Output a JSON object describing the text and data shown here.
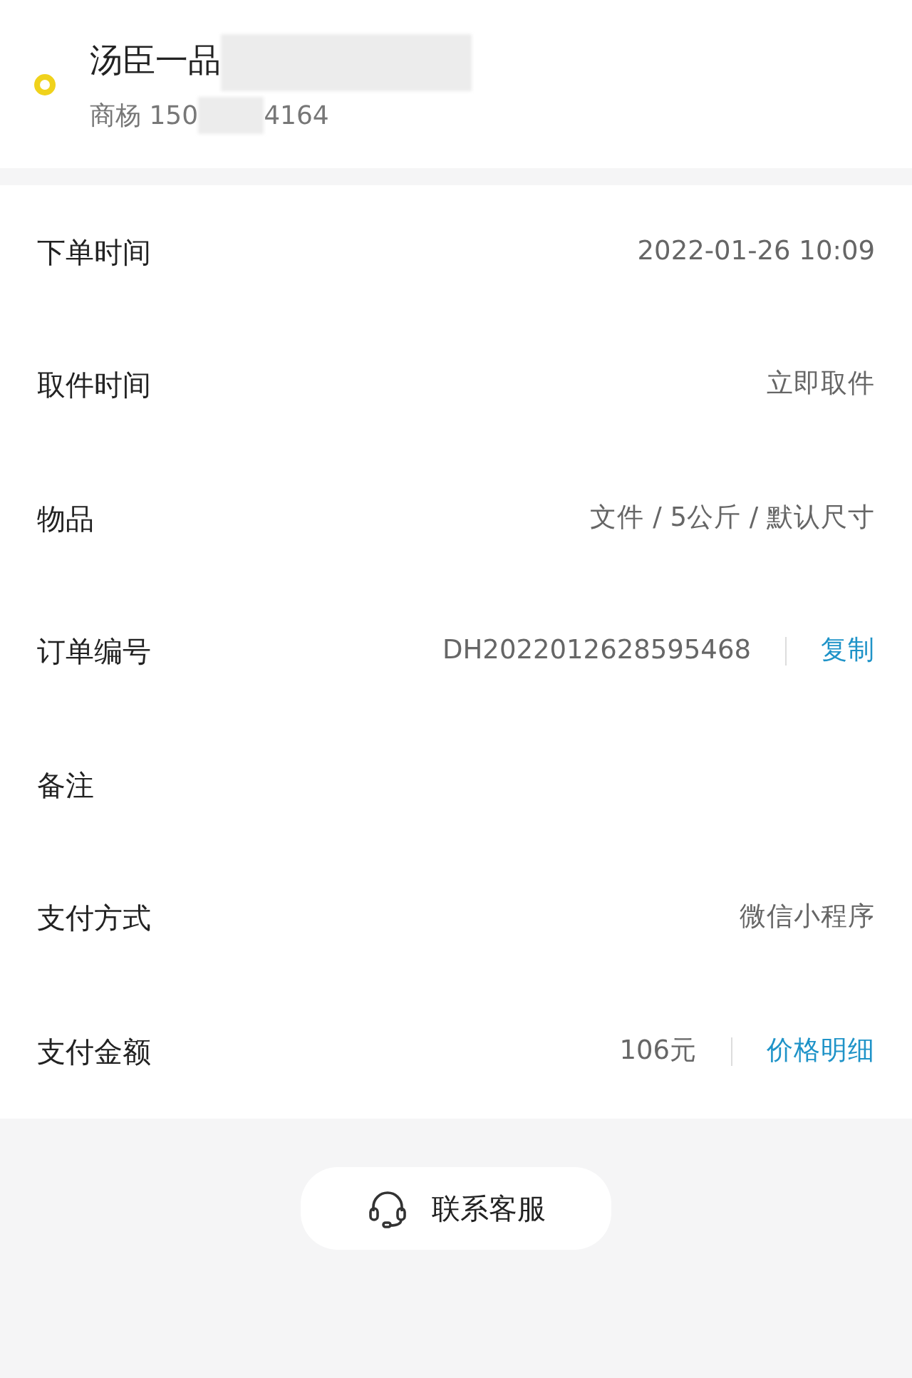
{
  "contact": {
    "name": "汤臣一品",
    "phone_start": "商杨 150",
    "phone_end": "4164"
  },
  "rows": [
    {
      "label": "下单时间",
      "value": "2022-01-26 10:09"
    },
    {
      "label": "取件时间",
      "value": "立即取件"
    },
    {
      "label": "物品",
      "value": "文件 / 5公斤 / 默认尺寸"
    },
    {
      "label": "订单编号",
      "value": "DH2022012628595468",
      "action": "复制"
    },
    {
      "label": "备注"
    },
    {
      "label": "支付方式",
      "value": "微信小程序"
    },
    {
      "label": "支付金额",
      "value": "106元",
      "action": "价格明细"
    }
  ],
  "support_button": "联系客服"
}
